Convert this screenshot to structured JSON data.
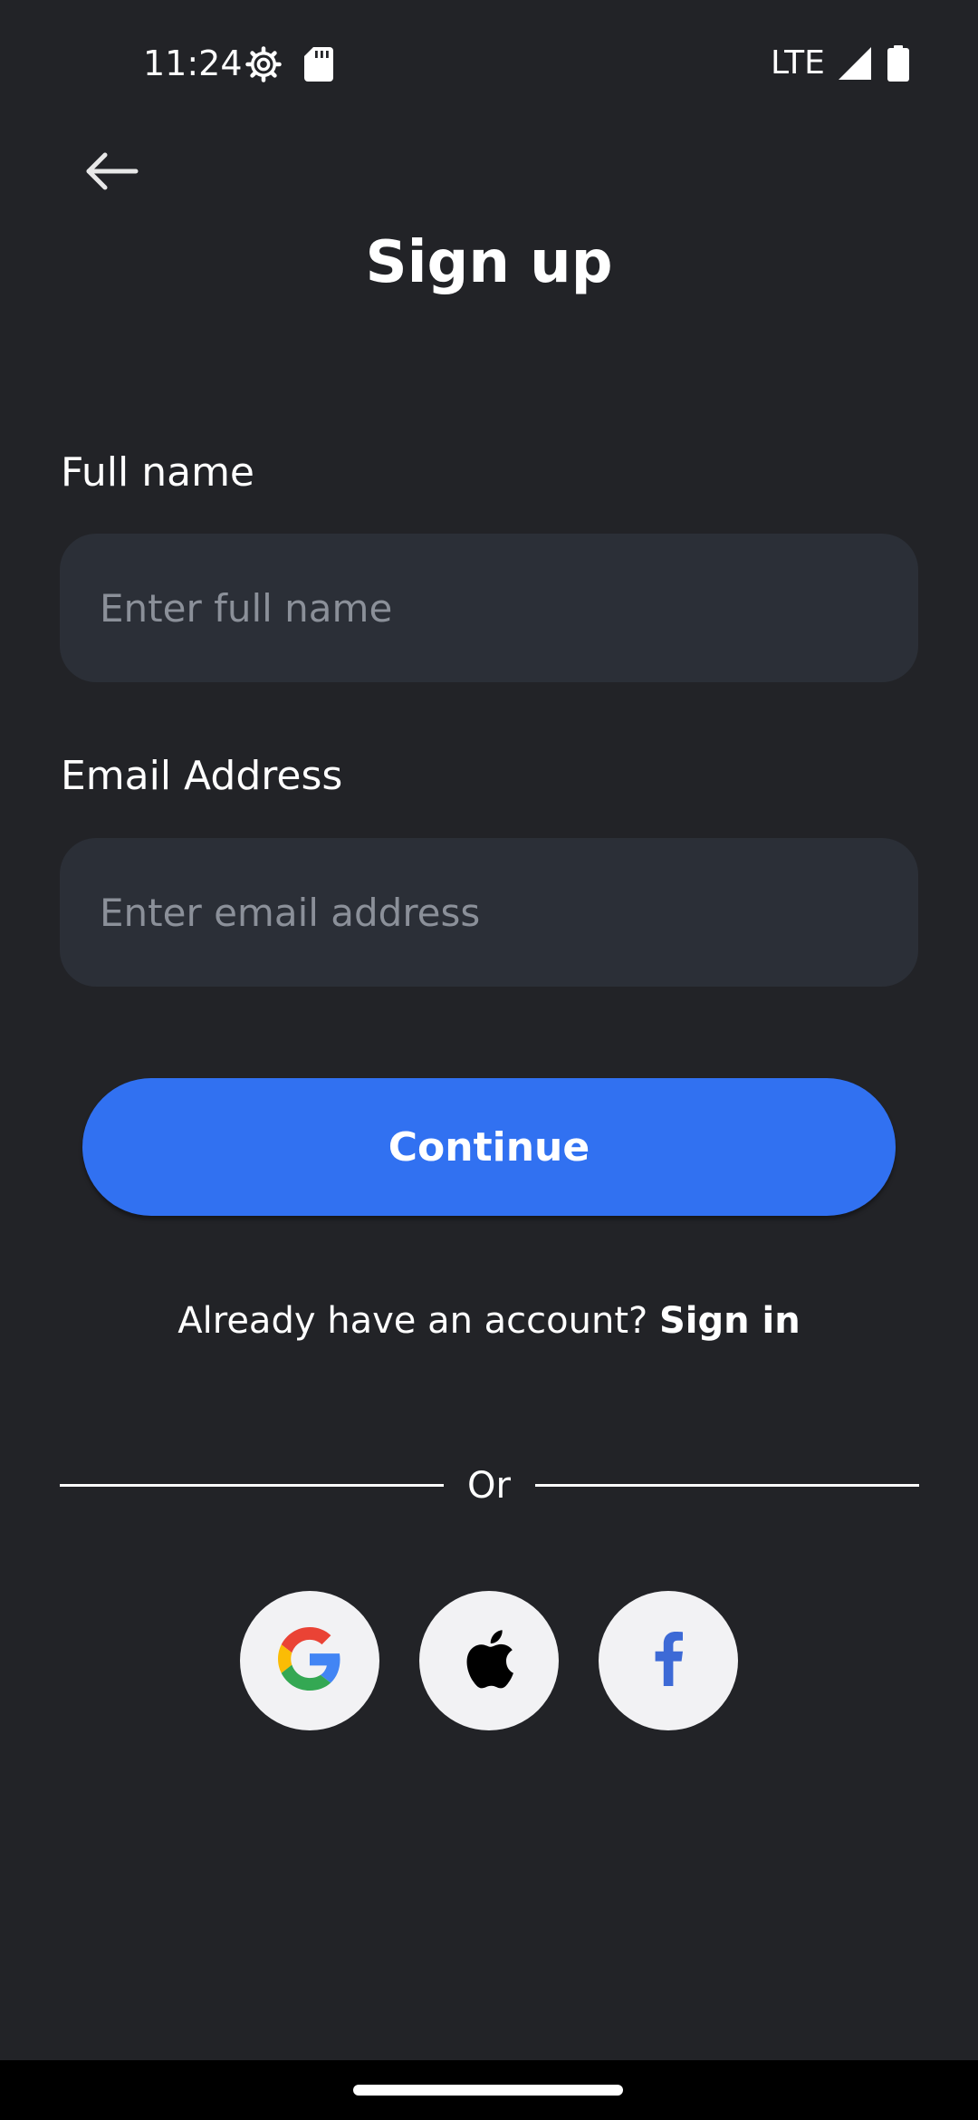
{
  "status_bar": {
    "time": "11:24",
    "network": "LTE",
    "icons": [
      "settings-gear-icon",
      "sd-card-icon",
      "signal-icon",
      "battery-icon"
    ]
  },
  "header": {
    "back_icon": "arrow-left-icon",
    "title": "Sign up"
  },
  "form": {
    "full_name": {
      "label": "Full name",
      "placeholder": "Enter full name",
      "value": ""
    },
    "email": {
      "label": "Email Address",
      "placeholder": "Enter email address",
      "value": ""
    },
    "continue_label": "Continue"
  },
  "signin": {
    "prompt": "Already have an account?",
    "link": "Sign in"
  },
  "divider": {
    "text": "Or"
  },
  "social": {
    "buttons": [
      "google-icon",
      "apple-icon",
      "facebook-icon"
    ]
  },
  "colors": {
    "background": "#222327",
    "input_background": "#2b2f37",
    "primary_button": "#3171f1",
    "social_button": "#f2f2f4",
    "facebook_blue": "#3d6ad6"
  }
}
